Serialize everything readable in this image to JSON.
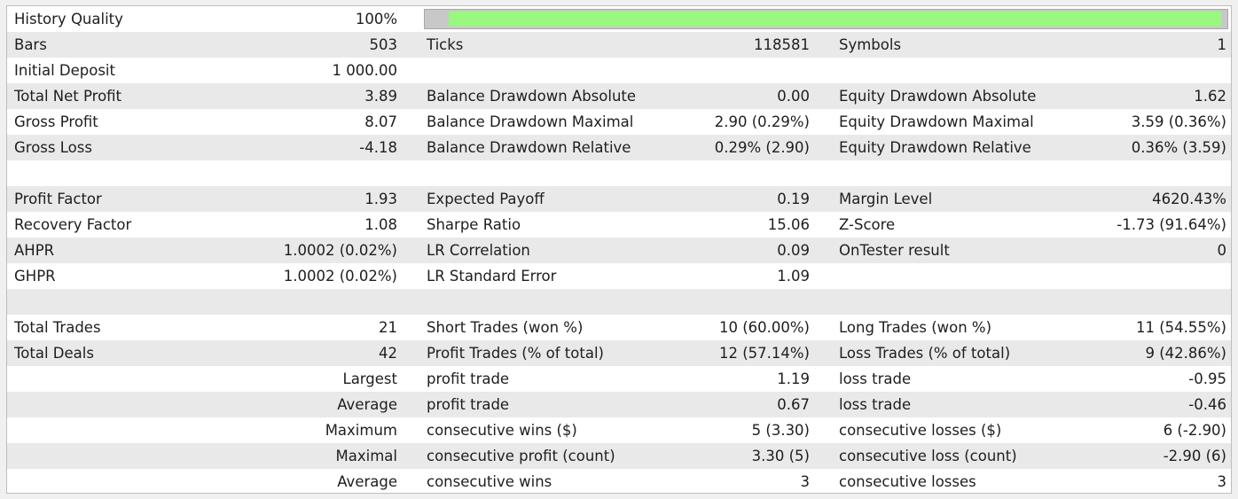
{
  "colors": {
    "row_alt": "#e9e9e9",
    "quality_fill": "#98f87f",
    "quality_track": "#c8c8c8"
  },
  "history_quality": {
    "label": "History Quality",
    "value": "100%",
    "fraction": 1.0
  },
  "rows": [
    {
      "c1": "Bars",
      "c2": "503",
      "c3": "Ticks",
      "c4": "118581",
      "c5": "Symbols",
      "c6": "1"
    },
    {
      "c1": "Initial Deposit",
      "c2": "1 000.00",
      "c3": "",
      "c4": "",
      "c5": "",
      "c6": ""
    },
    {
      "c1": "Total Net Profit",
      "c2": "3.89",
      "c3": "Balance Drawdown Absolute",
      "c4": "0.00",
      "c5": "Equity Drawdown Absolute",
      "c6": "1.62"
    },
    {
      "c1": "Gross Profit",
      "c2": "8.07",
      "c3": "Balance Drawdown Maximal",
      "c4": "2.90 (0.29%)",
      "c5": "Equity Drawdown Maximal",
      "c6": "3.59 (0.36%)"
    },
    {
      "c1": "Gross Loss",
      "c2": "-4.18",
      "c3": "Balance Drawdown Relative",
      "c4": "0.29% (2.90)",
      "c5": "Equity Drawdown Relative",
      "c6": "0.36% (3.59)"
    },
    {
      "c1": "",
      "c2": "",
      "c3": "",
      "c4": "",
      "c5": "",
      "c6": ""
    },
    {
      "c1": "Profit Factor",
      "c2": "1.93",
      "c3": "Expected Payoff",
      "c4": "0.19",
      "c5": "Margin Level",
      "c6": "4620.43%"
    },
    {
      "c1": "Recovery Factor",
      "c2": "1.08",
      "c3": "Sharpe Ratio",
      "c4": "15.06",
      "c5": "Z-Score",
      "c6": "-1.73 (91.64%)"
    },
    {
      "c1": "AHPR",
      "c2": "1.0002 (0.02%)",
      "c3": "LR Correlation",
      "c4": "0.09",
      "c5": "OnTester result",
      "c6": "0"
    },
    {
      "c1": "GHPR",
      "c2": "1.0002 (0.02%)",
      "c3": "LR Standard Error",
      "c4": "1.09",
      "c5": "",
      "c6": ""
    },
    {
      "c1": "",
      "c2": "",
      "c3": "",
      "c4": "",
      "c5": "",
      "c6": ""
    },
    {
      "c1": "Total Trades",
      "c2": "21",
      "c3": "Short Trades (won %)",
      "c4": "10 (60.00%)",
      "c5": "Long Trades (won %)",
      "c6": "11 (54.55%)"
    },
    {
      "c1": "Total Deals",
      "c2": "42",
      "c3": "Profit Trades (% of total)",
      "c4": "12 (57.14%)",
      "c5": "Loss Trades (% of total)",
      "c6": "9 (42.86%)"
    },
    {
      "c1": "",
      "c2": "Largest",
      "c3": "profit trade",
      "c4": "1.19",
      "c5": "loss trade",
      "c6": "-0.95"
    },
    {
      "c1": "",
      "c2": "Average",
      "c3": "profit trade",
      "c4": "0.67",
      "c5": "loss trade",
      "c6": "-0.46"
    },
    {
      "c1": "",
      "c2": "Maximum",
      "c3": "consecutive wins ($)",
      "c4": "5 (3.30)",
      "c5": "consecutive losses ($)",
      "c6": "6 (-2.90)"
    },
    {
      "c1": "",
      "c2": "Maximal",
      "c3": "consecutive profit (count)",
      "c4": "3.30 (5)",
      "c5": "consecutive loss (count)",
      "c6": "-2.90 (6)"
    },
    {
      "c1": "",
      "c2": "Average",
      "c3": "consecutive wins",
      "c4": "3",
      "c5": "consecutive losses",
      "c6": "3"
    }
  ]
}
